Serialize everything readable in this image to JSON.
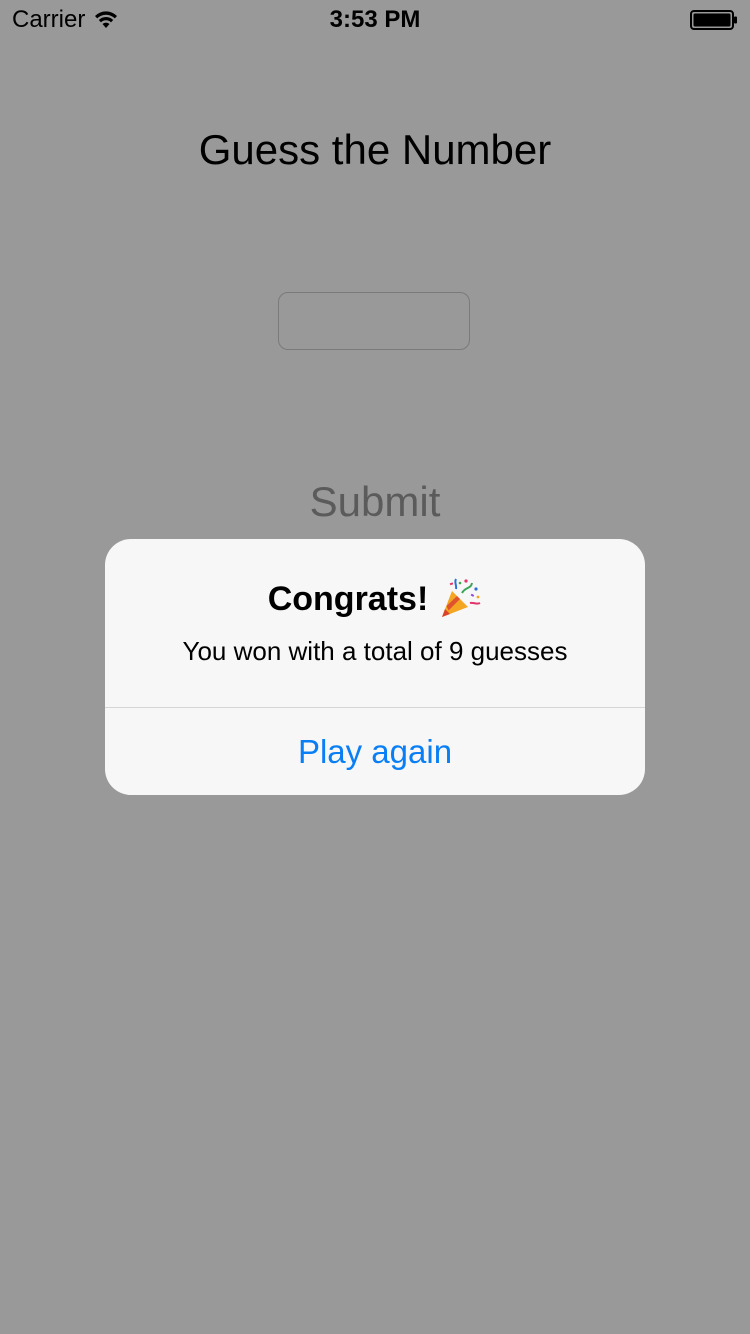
{
  "status_bar": {
    "carrier": "Carrier",
    "time": "3:53 PM",
    "wifi_icon": "wifi-icon",
    "battery_icon": "battery-icon"
  },
  "main": {
    "title": "Guess the Number",
    "guess_input": {
      "value": "",
      "placeholder": ""
    },
    "submit_label": "Submit"
  },
  "alert": {
    "title": "Congrats!",
    "title_icon": "party-popper-icon",
    "message": "You won with a total of 9 guesses",
    "action_label": "Play again"
  },
  "colors": {
    "background_dim": "#999999",
    "alert_background": "#f7f7f7",
    "action_tint": "#0a7ff5"
  }
}
